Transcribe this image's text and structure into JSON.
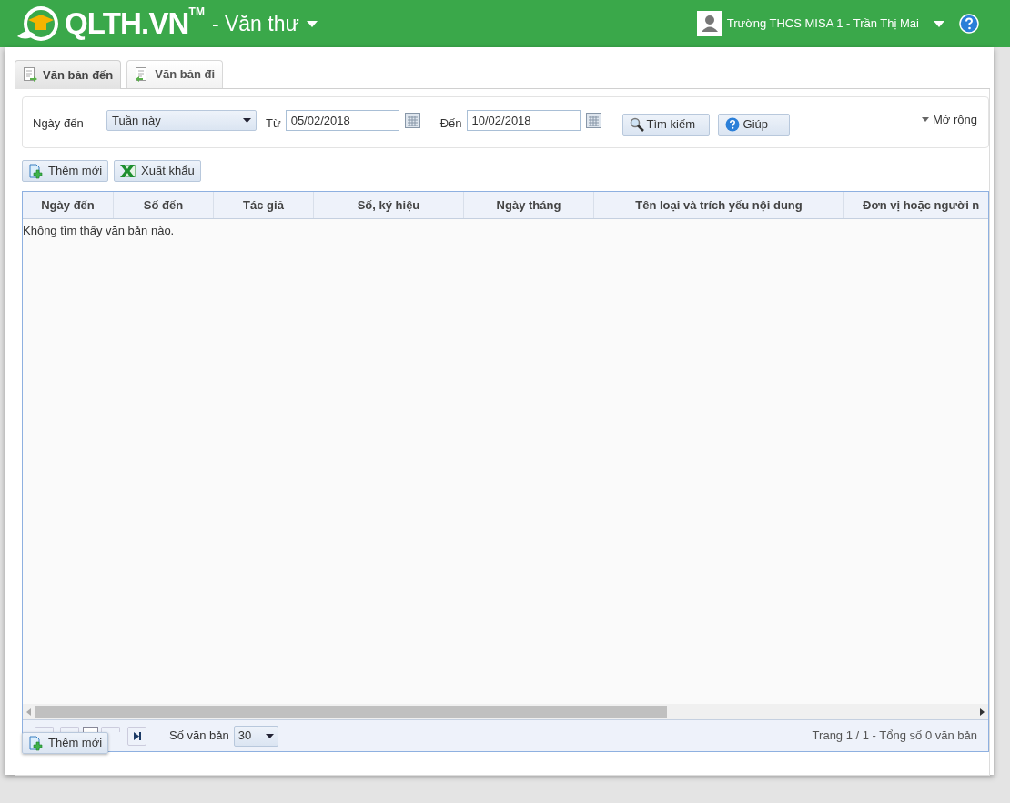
{
  "header": {
    "logo": "QLTH.VN",
    "trademark": "TM",
    "module": "- Văn thư",
    "user": "Trường THCS MISA 1 - Trần Thị Mai"
  },
  "tabs": [
    {
      "label": "Văn bản đến",
      "selected": true
    },
    {
      "label": "Văn bản đi",
      "selected": false
    }
  ],
  "filter": {
    "label": "Ngày đến",
    "period": "Tuần này",
    "from_label": "Từ",
    "from": "05/02/2018",
    "to_label": "Đến",
    "to": "10/02/2018",
    "search_button": "Tìm kiếm",
    "help_button": "Giúp",
    "expand": "Mở rộng"
  },
  "toolbar": [
    "Thêm mới",
    "Xuất khẩu"
  ],
  "table": {
    "columns": [
      "Ngày đến",
      "Số đến",
      "Tác giả",
      "Số, ký hiệu",
      "Ngày tháng",
      "Tên loại và trích yếu nội dung",
      "Đơn vị hoặc người n"
    ],
    "empty_message": "Không tìm thấy văn bản nào."
  },
  "pager": {
    "page_size_label": "Số văn bản",
    "page_size": "30",
    "summary": "Trang 1 / 1 - Tổng số 0 văn bản"
  },
  "floating_button": "Thêm mới"
}
